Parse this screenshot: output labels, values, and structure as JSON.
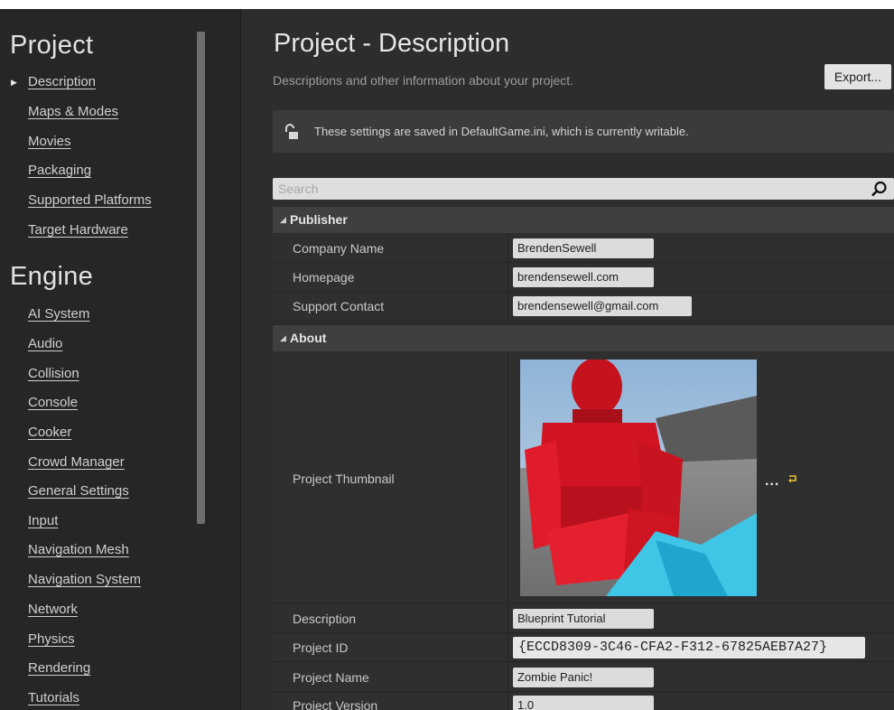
{
  "sidebar": {
    "project_title": "Project",
    "project_items": [
      {
        "label": "Description",
        "selected": true
      },
      {
        "label": "Maps & Modes"
      },
      {
        "label": "Movies"
      },
      {
        "label": "Packaging"
      },
      {
        "label": "Supported Platforms"
      },
      {
        "label": "Target Hardware"
      }
    ],
    "engine_title": "Engine",
    "engine_items": [
      {
        "label": "AI System"
      },
      {
        "label": "Audio"
      },
      {
        "label": "Collision"
      },
      {
        "label": "Console"
      },
      {
        "label": "Cooker"
      },
      {
        "label": "Crowd Manager"
      },
      {
        "label": "General Settings"
      },
      {
        "label": "Input"
      },
      {
        "label": "Navigation Mesh"
      },
      {
        "label": "Navigation System"
      },
      {
        "label": "Network"
      },
      {
        "label": "Physics"
      },
      {
        "label": "Rendering"
      },
      {
        "label": "Tutorials"
      }
    ]
  },
  "main": {
    "title": "Project - Description",
    "subtitle": "Descriptions and other information about your project.",
    "export_label": "Export...",
    "notice": "These settings are saved in DefaultGame.ini, which is currently writable.",
    "search_placeholder": "Search",
    "publisher": {
      "header": "Publisher",
      "company_name_label": "Company Name",
      "company_name_value": "BrendenSewell",
      "homepage_label": "Homepage",
      "homepage_value": "brendensewell.com",
      "support_contact_label": "Support Contact",
      "support_contact_value": "brendensewell@gmail.com"
    },
    "about": {
      "header": "About",
      "thumbnail_label": "Project Thumbnail",
      "thumbnail_menu": "...",
      "description_label": "Description",
      "description_value": "Blueprint Tutorial",
      "project_id_label": "Project ID",
      "project_id_value": "{ECCD8309-3C46-CFA2-F312-67825AEB7A27}",
      "project_name_label": "Project Name",
      "project_name_value": "Zombie Panic!",
      "project_version_label": "Project Version",
      "project_version_value": "1.0"
    }
  },
  "colors": {
    "panel": "#2d2d2d",
    "sidebar": "#262626",
    "category_header": "#3f3f3f",
    "value_field": "#dcdcdc",
    "reset_icon": "#e8c330"
  }
}
